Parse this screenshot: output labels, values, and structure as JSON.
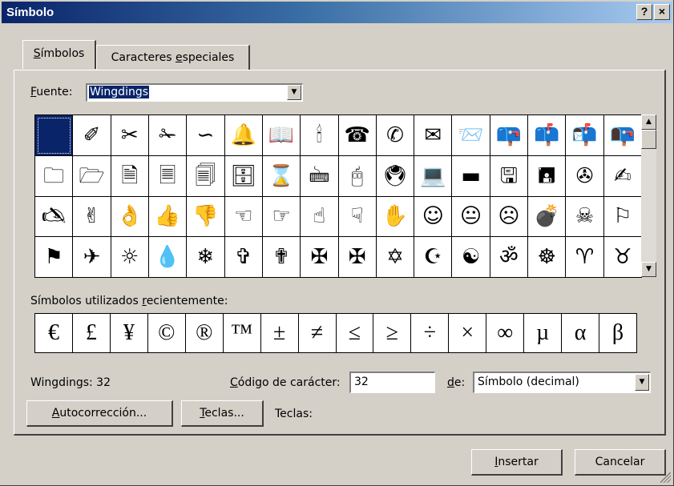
{
  "window": {
    "title": "Símbolo",
    "help_button": "?",
    "close_button": "×"
  },
  "tabs": [
    {
      "label_u": "S",
      "label_rest": "ímbolos",
      "selected": true
    },
    {
      "label_pre": "Caracteres ",
      "label_u": "e",
      "label_rest": "speciales",
      "selected": false
    }
  ],
  "font": {
    "label_u": "F",
    "label_rest": "uente:",
    "value": "Wingdings"
  },
  "symbols": [
    "",
    "✐",
    "✂",
    "✁",
    "∽",
    "🔔",
    "📖",
    "🕯",
    "☎",
    "✆",
    "✉",
    "📨",
    "📪",
    "📫",
    "📬",
    "📭",
    "🗀",
    "🗁",
    "🗎",
    "🗏",
    "🗐",
    "🗄",
    "⌛",
    "🖮",
    "🖰",
    "🖲",
    "💻",
    "▬",
    "🖫",
    "🖪",
    "✇",
    "✍",
    "🖎",
    "✌",
    "👌",
    "👍",
    "👎",
    "☜",
    "☞",
    "☝",
    "☟",
    "✋",
    "☺",
    "😐",
    "☹",
    "💣",
    "☠",
    "⚐",
    "⚑",
    "✈",
    "☼",
    "💧",
    "❄",
    "✞",
    "✟",
    "✠",
    "✠",
    "✡",
    "☪",
    "☯",
    "ॐ",
    "☸",
    "♈",
    "♉"
  ],
  "selected_index": 0,
  "recent": {
    "label_pre": "Símbolos utilizados ",
    "label_u": "r",
    "label_rest": "ecientemente:",
    "symbols": [
      "€",
      "£",
      "¥",
      "©",
      "®",
      "™",
      "±",
      "≠",
      "≤",
      "≥",
      "÷",
      "×",
      "∞",
      "µ",
      "α",
      "β"
    ]
  },
  "status": {
    "font_code": "Wingdings: 32",
    "char_code_label_u": "C",
    "char_code_label_rest": "ódigo de carácter:",
    "char_code_value": "32",
    "de_label_u": "d",
    "de_label_rest": "e:",
    "de_value": "Símbolo (decimal)"
  },
  "buttons": {
    "autocorrect_u": "A",
    "autocorrect_rest": "utocorrección...",
    "keys_u": "T",
    "keys_rest": "eclas...",
    "keys_label": "Teclas:",
    "insert_u": "I",
    "insert_rest": "nsertar",
    "cancel": "Cancelar"
  }
}
